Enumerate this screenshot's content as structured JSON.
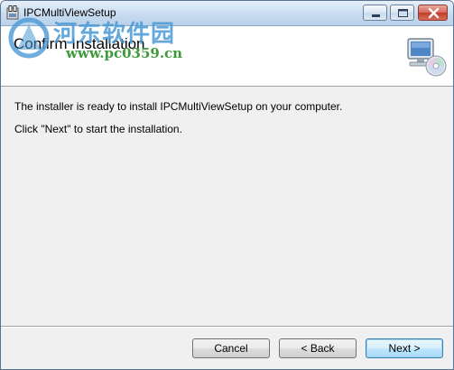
{
  "window": {
    "title": "IPCMultiViewSetup",
    "controls": {
      "minimize": "minimize-icon",
      "maximize": "maximize-icon",
      "close": "close-icon"
    }
  },
  "header": {
    "title": "Confirm Installation",
    "watermark_text": "河东软件园",
    "watermark_url": "www.pc0359.cn",
    "icon": "computer-cd-icon"
  },
  "body": {
    "line1": "The installer is ready to install IPCMultiViewSetup on your computer.",
    "line2": "Click \"Next\" to start the installation."
  },
  "buttons": {
    "cancel": "Cancel",
    "back": "< Back",
    "next": "Next >"
  },
  "colors": {
    "titlebar": "#c8dcf0",
    "close_button": "#c33c2c",
    "watermark_blue": "#4a9ad6",
    "watermark_green": "#3e9a3a",
    "default_button_border": "#3c7fb1"
  }
}
